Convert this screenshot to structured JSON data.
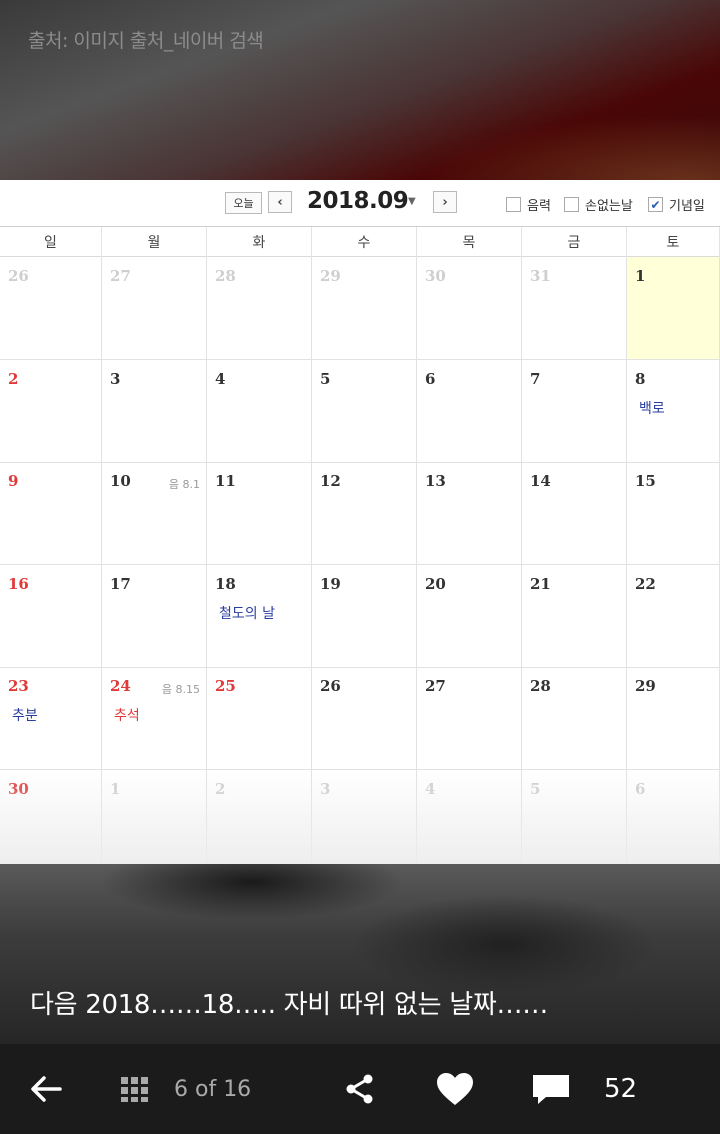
{
  "header": {
    "source_text": "출처: 이미지 출처_네이버 검색"
  },
  "calendar": {
    "today_button": "오늘",
    "prev_symbol": "‹",
    "next_symbol": "›",
    "month": "2018.09",
    "options": [
      {
        "label": "음력",
        "checked": false
      },
      {
        "label": "손없는날",
        "checked": false
      },
      {
        "label": "기념일",
        "checked": true
      }
    ],
    "weekdays": [
      "일",
      "월",
      "화",
      "수",
      "목",
      "금",
      "토"
    ],
    "weeks": [
      [
        {
          "day": "26",
          "faded": true
        },
        {
          "day": "27",
          "faded": true
        },
        {
          "day": "28",
          "faded": true
        },
        {
          "day": "29",
          "faded": true
        },
        {
          "day": "30",
          "faded": true
        },
        {
          "day": "31",
          "faded": true
        },
        {
          "day": "1",
          "highlight": true
        }
      ],
      [
        {
          "day": "2",
          "red": true
        },
        {
          "day": "3"
        },
        {
          "day": "4"
        },
        {
          "day": "5"
        },
        {
          "day": "6"
        },
        {
          "day": "7"
        },
        {
          "day": "8",
          "event": "백로"
        }
      ],
      [
        {
          "day": "9",
          "red": true
        },
        {
          "day": "10",
          "lunar": "음 8.1"
        },
        {
          "day": "11"
        },
        {
          "day": "12"
        },
        {
          "day": "13"
        },
        {
          "day": "14"
        },
        {
          "day": "15"
        }
      ],
      [
        {
          "day": "16",
          "red": true
        },
        {
          "day": "17"
        },
        {
          "day": "18",
          "event": "철도의 날"
        },
        {
          "day": "19"
        },
        {
          "day": "20"
        },
        {
          "day": "21"
        },
        {
          "day": "22"
        }
      ],
      [
        {
          "day": "23",
          "red": true,
          "event": "추분"
        },
        {
          "day": "24",
          "red": true,
          "lunar": "음 8.15",
          "event": "추석",
          "event_red": true
        },
        {
          "day": "25",
          "red": true
        },
        {
          "day": "26"
        },
        {
          "day": "27"
        },
        {
          "day": "28"
        },
        {
          "day": "29"
        }
      ],
      [
        {
          "day": "30",
          "red": true
        },
        {
          "day": "1",
          "faded": true
        },
        {
          "day": "2",
          "faded": true
        },
        {
          "day": "3",
          "faded": true
        },
        {
          "day": "4",
          "faded": true
        },
        {
          "day": "5",
          "faded": true
        },
        {
          "day": "6",
          "faded": true
        }
      ]
    ]
  },
  "caption": "다음 2018……18….. 자비 따위 없는 날짜……",
  "toolbar": {
    "page_counter": "6 of 16",
    "comment_count": "52",
    "icons": [
      "back-arrow-icon",
      "grid-icon",
      "share-icon",
      "heart-icon",
      "comment-icon"
    ]
  }
}
